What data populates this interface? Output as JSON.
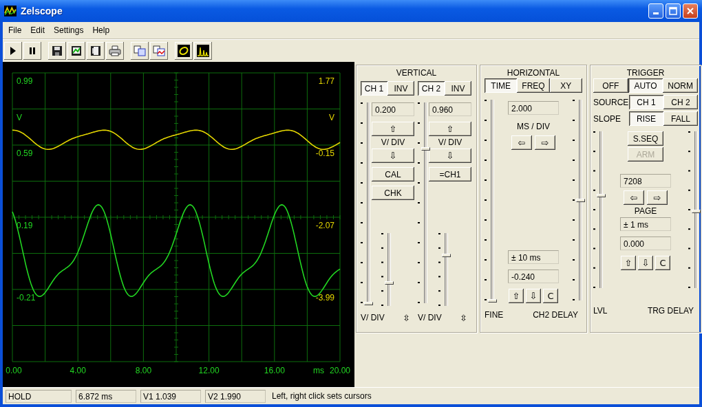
{
  "window": {
    "title": "Zelscope"
  },
  "menu": [
    {
      "label": "File"
    },
    {
      "label": "Edit"
    },
    {
      "label": "Settings"
    },
    {
      "label": "Help"
    }
  ],
  "scope": {
    "left_labels": [
      "0.99",
      "V",
      "0.59",
      "0.19",
      "-0.21"
    ],
    "right_labels": [
      "1.77",
      "V",
      "-0.15",
      "-2.07",
      "-3.99"
    ],
    "x_labels": [
      "0.00",
      "4.00",
      "8.00",
      "12.00",
      "16.00",
      "ms",
      "20.00"
    ]
  },
  "vertical": {
    "title": "VERTICAL",
    "channels": [
      {
        "tab": {
          "label": "CH 1",
          "selected": true
        },
        "invert": {
          "label": "INV",
          "selected": false
        },
        "slider": {
          "level": 0
        },
        "readout": "0.200",
        "up": "⇧",
        "unit": "V/ DIV",
        "down": "⇩",
        "buttons": [
          {
            "label": "CAL"
          },
          {
            "label": "CHK"
          }
        ],
        "fine": {
          "level": 0.32
        },
        "footer": "V/ DIV",
        "footer_icon": "⇳"
      },
      {
        "tab": {
          "label": "CH 2",
          "selected": true
        },
        "invert": {
          "label": "INV",
          "selected": false
        },
        "slider": {
          "level": 0.77
        },
        "readout": "0.960",
        "up": "⇧",
        "unit": "V/ DIV",
        "down": "⇩",
        "buttons": [
          {
            "label": "=CH1"
          }
        ],
        "fine": {
          "level": 0.7
        },
        "footer": "V/ DIV",
        "footer_icon": "⇳"
      }
    ]
  },
  "horizontal": {
    "title": "HORIZONTAL",
    "tabs": [
      {
        "label": "TIME",
        "selected": true
      },
      {
        "label": "FREQ",
        "selected": false
      },
      {
        "label": "XY",
        "selected": false
      }
    ],
    "fine_slider": {
      "level": 0
    },
    "readout": "2.000",
    "unit": "MS / DIV",
    "left": "⇦",
    "right": "⇨",
    "range": "± 10 ms",
    "delay": "-0.240",
    "buttons": [
      {
        "label": "⇧"
      },
      {
        "label": "⇩"
      },
      {
        "label": "C"
      }
    ],
    "delay_slider": {
      "level": 0.5
    },
    "footer_left": "FINE",
    "footer_right": "CH2 DELAY"
  },
  "trigger": {
    "title": "TRIGGER",
    "modes": [
      {
        "label": "OFF",
        "selected": false
      },
      {
        "label": "AUTO",
        "selected": true
      },
      {
        "label": "NORM",
        "selected": false
      }
    ],
    "source": {
      "label": "SOURCE",
      "options": [
        {
          "label": "CH 1",
          "selected": true
        },
        {
          "label": "CH 2",
          "selected": false
        }
      ]
    },
    "slope": {
      "label": "SLOPE",
      "options": [
        {
          "label": "RISE",
          "selected": true
        },
        {
          "label": "FALL",
          "selected": false
        }
      ]
    },
    "single": {
      "label": "S.SEQ",
      "disabled": false
    },
    "arm": {
      "label": "ARM",
      "disabled": true
    },
    "count": "7208",
    "left": "⇦",
    "right": "⇨",
    "page": "PAGE",
    "range": "± 1 ms",
    "delay": "0.000",
    "buttons": [
      {
        "label": "⇧"
      },
      {
        "label": "⇩"
      },
      {
        "label": "C"
      }
    ],
    "level_slider": {
      "level": 0.59
    },
    "delay_slider": {
      "level": 0.49
    },
    "footer_left": "LVL",
    "footer_right": "TRG DELAY"
  },
  "status_bar": [
    "HOLD",
    "6.872 ms",
    "V1 1.039",
    "V2 1.990",
    "Left, right click sets cursors"
  ]
}
